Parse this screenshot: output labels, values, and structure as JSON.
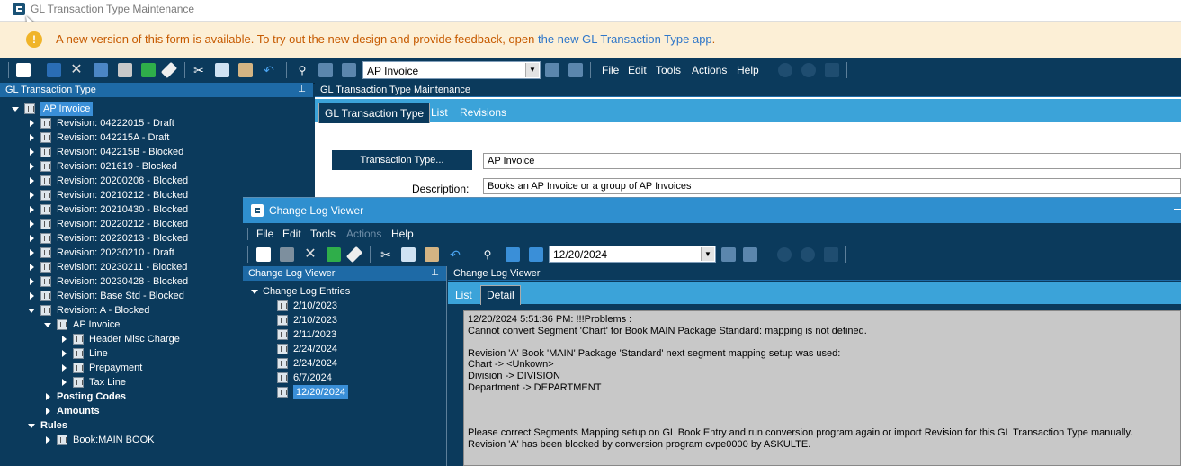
{
  "main_window": {
    "title": "GL Transaction Type Maintenance"
  },
  "banner": {
    "icon": "warning-icon",
    "message": "A new version of this form is available. To try out the new design and provide feedback, open",
    "link_text": "the new GL Transaction Type app",
    "suffix": "."
  },
  "toolbar": {
    "combo_value": "AP Invoice",
    "menus": [
      "File",
      "Edit",
      "Tools",
      "Actions",
      "Help"
    ]
  },
  "left_panel": {
    "title": "GL Transaction Type",
    "tree": [
      {
        "label": "AP Invoice",
        "level": 0,
        "expanded": true,
        "selected": true,
        "icon": "book-icon"
      },
      {
        "label": "Revision: 04222015 - Draft",
        "level": 1,
        "icon": "book-icon"
      },
      {
        "label": "Revision: 042215A - Draft",
        "level": 1,
        "icon": "book-icon"
      },
      {
        "label": "Revision: 042215B - Blocked",
        "level": 1,
        "icon": "book-icon"
      },
      {
        "label": "Revision: 021619 - Blocked",
        "level": 1,
        "icon": "book-icon"
      },
      {
        "label": "Revision: 20200208 - Blocked",
        "level": 1,
        "icon": "book-icon"
      },
      {
        "label": "Revision: 20210212 - Blocked",
        "level": 1,
        "icon": "book-icon"
      },
      {
        "label": "Revision: 20210430 - Blocked",
        "level": 1,
        "icon": "book-icon"
      },
      {
        "label": "Revision: 20220212 - Blocked",
        "level": 1,
        "icon": "book-icon"
      },
      {
        "label": "Revision: 20220213 - Blocked",
        "level": 1,
        "icon": "book-icon"
      },
      {
        "label": "Revision: 20230210 - Draft",
        "level": 1,
        "icon": "book-icon"
      },
      {
        "label": "Revision: 20230211 - Blocked",
        "level": 1,
        "icon": "book-icon"
      },
      {
        "label": "Revision: 20230428 - Blocked",
        "level": 1,
        "icon": "book-icon"
      },
      {
        "label": "Revision: Base Std - Blocked",
        "level": 1,
        "icon": "book-icon"
      },
      {
        "label": "Revision: A - Blocked",
        "level": 1,
        "expanded": true,
        "icon": "book-icon"
      },
      {
        "label": "AP Invoice",
        "level": 2,
        "expanded": true,
        "icon": "book-icon"
      },
      {
        "label": "Header Misc Charge",
        "level": 3,
        "icon": "book-icon"
      },
      {
        "label": "Line",
        "level": 3,
        "icon": "book-icon"
      },
      {
        "label": "Prepayment",
        "level": 3,
        "icon": "book-icon"
      },
      {
        "label": "Tax Line",
        "level": 3,
        "icon": "book-icon"
      },
      {
        "label": "Posting Codes",
        "level": 2,
        "bold": true
      },
      {
        "label": "Amounts",
        "level": 2,
        "bold": true
      },
      {
        "label": "Rules",
        "level": 1,
        "bold": true,
        "expanded": true
      },
      {
        "label": "Book:MAIN BOOK",
        "level": 2,
        "icon": "book-icon"
      }
    ]
  },
  "right_panel": {
    "title": "GL Transaction Type Maintenance",
    "tabs": [
      "GL Transaction Type",
      "List",
      "Revisions"
    ],
    "transaction_type_button": "Transaction Type...",
    "transaction_type_value": "AP Invoice",
    "description_label": "Description:",
    "description_value": "Books an AP Invoice or a group of AP Invoices"
  },
  "change_log_viewer": {
    "title": "Change Log Viewer",
    "menus": [
      "File",
      "Edit",
      "Tools",
      "Actions",
      "Help"
    ],
    "date_combo": "12/20/2024",
    "left_title": "Change Log Viewer",
    "root_label": "Change Log Entries",
    "entries": [
      "2/10/2023",
      "2/10/2023",
      "2/11/2023",
      "2/24/2024",
      "2/24/2024",
      "6/7/2024",
      "12/20/2024"
    ],
    "selected_entry": "12/20/2024",
    "right_title": "Change Log Viewer",
    "tabs": [
      "List",
      "Detail"
    ],
    "log_lines": [
      "12/20/2024 5:51:36 PM: !!!Problems :",
      "Cannot convert Segment 'Chart' for  Book MAIN Package Standard: mapping is not defined.",
      "",
      "Revision 'A' Book 'MAIN' Package 'Standard' next segment mapping setup was used:",
      "Chart  ->   <Unkown>",
      "Division  ->   DIVISION",
      "Department   ->   DEPARTMENT",
      "",
      "",
      "",
      "Please correct Segments Mapping setup on GL Book Entry and run conversion program again or import Revision for this GL Transaction Type manually.",
      "Revision 'A' has been blocked by conversion program cvpe0000 by ASKULTE."
    ]
  },
  "colors": {
    "dark_bg": "#0b3a5c",
    "accent": "#3ba3d9",
    "banner_bg": "#fcefd6",
    "banner_text": "#c65a00",
    "link": "#2f77c9"
  }
}
